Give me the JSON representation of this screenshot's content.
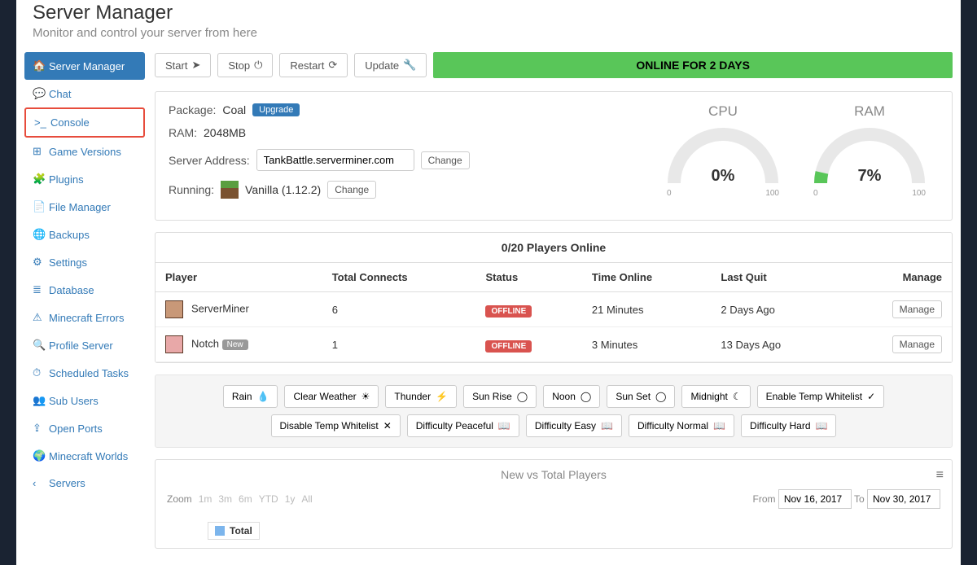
{
  "header": {
    "title": "Server Manager",
    "subtitle": "Monitor and control your server from here"
  },
  "sidebar": {
    "items": [
      {
        "label": "Server Manager",
        "active": true
      },
      {
        "label": "Chat"
      },
      {
        "label": "Console",
        "highlight": true
      },
      {
        "label": "Game Versions"
      },
      {
        "label": "Plugins"
      },
      {
        "label": "File Manager"
      },
      {
        "label": "Backups"
      },
      {
        "label": "Settings"
      },
      {
        "label": "Database"
      },
      {
        "label": "Minecraft Errors"
      },
      {
        "label": "Profile Server"
      },
      {
        "label": "Scheduled Tasks"
      },
      {
        "label": "Sub Users"
      },
      {
        "label": "Open Ports"
      },
      {
        "label": "Minecraft Worlds"
      },
      {
        "label": "Servers"
      }
    ]
  },
  "toolbar": {
    "start": "Start",
    "stop": "Stop",
    "restart": "Restart",
    "update": "Update",
    "status": "ONLINE FOR 2 DAYS"
  },
  "info": {
    "package_label": "Package:",
    "package_value": "Coal",
    "upgrade": "Upgrade",
    "ram_label": "RAM:",
    "ram_value": "2048MB",
    "address_label": "Server Address:",
    "address_value": "TankBattle.serverminer.com",
    "change": "Change",
    "running_label": "Running:",
    "running_value": "Vanilla (1.12.2)"
  },
  "gauges": {
    "cpu": {
      "title": "CPU",
      "value": "0%",
      "min": "0",
      "max": "100",
      "pct": 0
    },
    "ram": {
      "title": "RAM",
      "value": "7%",
      "min": "0",
      "max": "100",
      "pct": 7
    }
  },
  "players": {
    "header": "0/20 Players Online",
    "cols": {
      "player": "Player",
      "connects": "Total Connects",
      "status": "Status",
      "time": "Time Online",
      "quit": "Last Quit",
      "manage": "Manage"
    },
    "rows": [
      {
        "name": "ServerMiner",
        "connects": "6",
        "status": "OFFLINE",
        "time": "21 Minutes",
        "quit": "2 Days Ago",
        "manage": "Manage",
        "new": false
      },
      {
        "name": "Notch",
        "connects": "1",
        "status": "OFFLINE",
        "time": "3 Minutes",
        "quit": "13 Days Ago",
        "manage": "Manage",
        "new": true,
        "new_label": "New"
      }
    ]
  },
  "quick_actions": [
    "Rain",
    "Clear Weather",
    "Thunder",
    "Sun Rise",
    "Noon",
    "Sun Set",
    "Midnight",
    "Enable Temp Whitelist",
    "Disable Temp Whitelist",
    "Difficulty Peaceful",
    "Difficulty Easy",
    "Difficulty Normal",
    "Difficulty Hard"
  ],
  "chart": {
    "title": "New vs Total Players",
    "zoom_label": "Zoom",
    "zoom_opts": [
      "1m",
      "3m",
      "6m",
      "YTD",
      "1y",
      "All"
    ],
    "from_label": "From",
    "from_value": "Nov 16, 2017",
    "to_label": "To",
    "to_value": "Nov 30, 2017",
    "legend_total": "Total"
  }
}
